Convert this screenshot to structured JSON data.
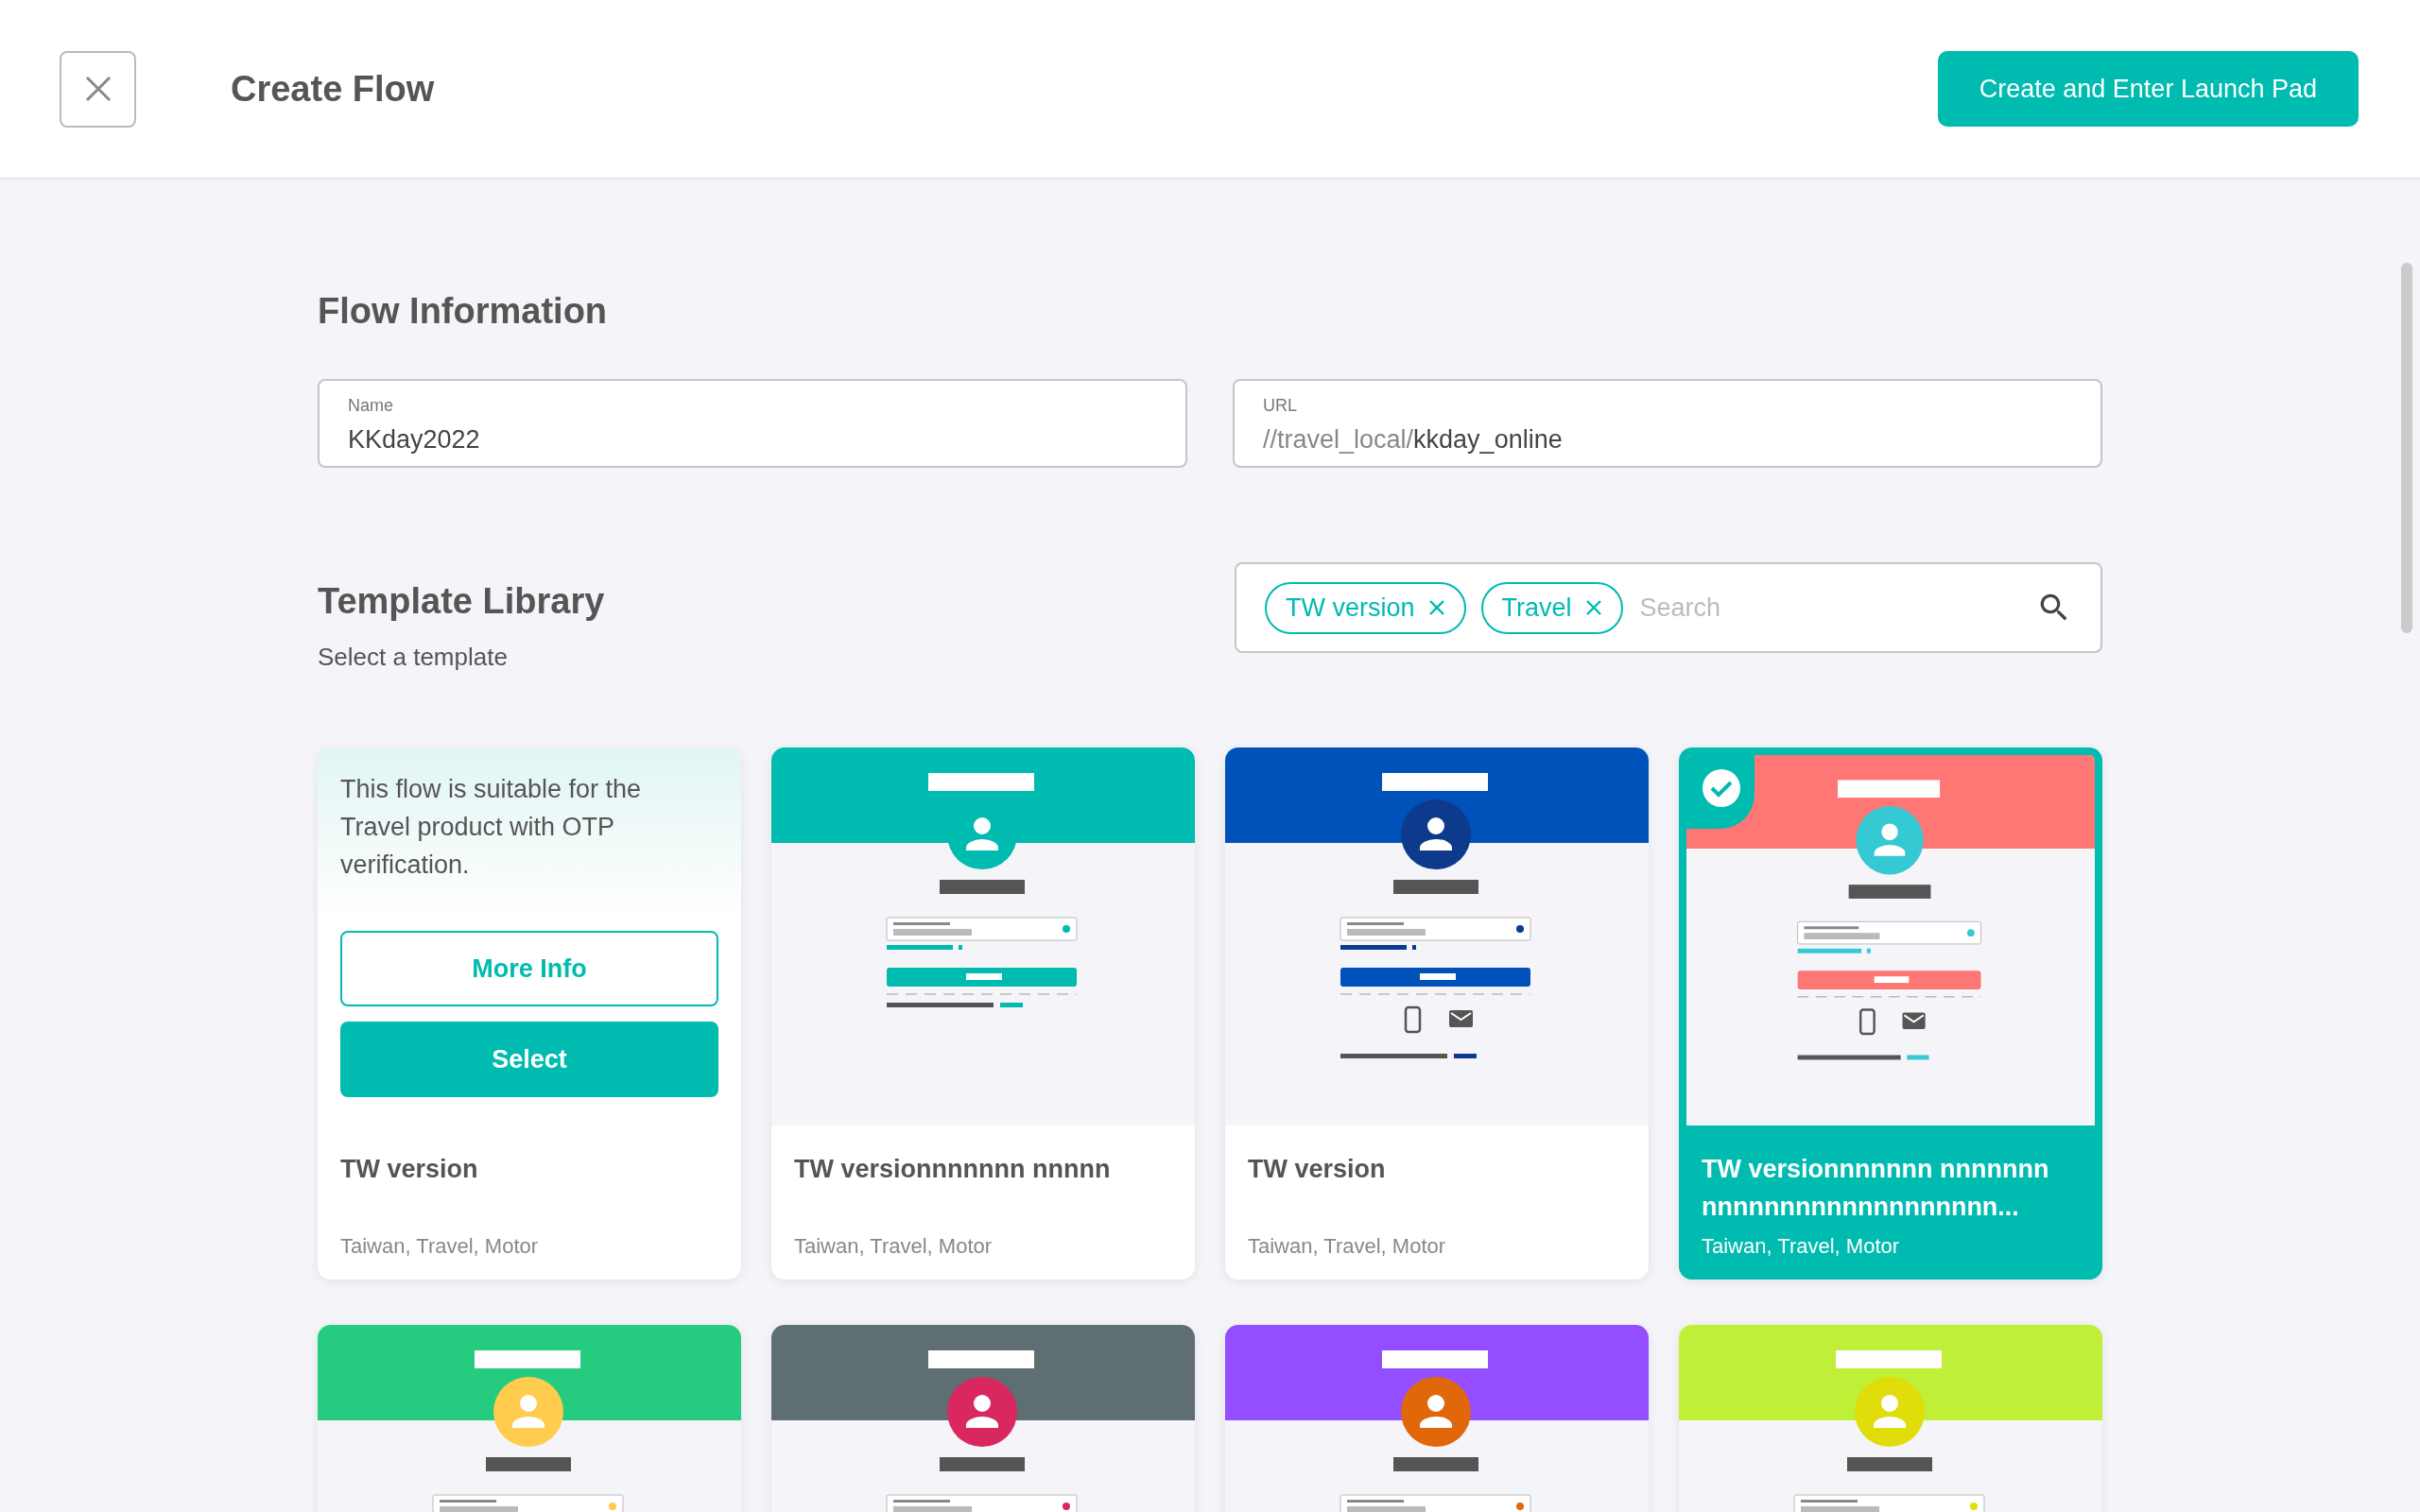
{
  "header": {
    "title": "Create Flow",
    "primary_button": "Create and Enter Launch Pad"
  },
  "flow_information": {
    "heading": "Flow Information",
    "name": {
      "label": "Name",
      "value": "KKday2022"
    },
    "url": {
      "label": "URL",
      "prefix": "//travel_local/",
      "value": "kkday_online"
    }
  },
  "template_library": {
    "heading": "Template Library",
    "subheading": "Select a template",
    "search": {
      "placeholder": "Search",
      "chips": [
        {
          "label": "TW version"
        },
        {
          "label": "Travel"
        }
      ]
    },
    "templates": [
      {
        "title": "TW version",
        "tags": "Taiwan, Travel, Motor",
        "selected": false,
        "hovered": true,
        "description": "This flow is suitable for the Travel product with OTP verification.",
        "more_info": "More Info",
        "select": "Select"
      },
      {
        "title": "TW versionnnnnnn nnnnn",
        "tags": "Taiwan, Travel, Motor",
        "selected": false,
        "hovered": false,
        "color": "#00bbb0",
        "avatar": {
          "color": "#00bbb0"
        },
        "contact_icons": false
      },
      {
        "title": "TW version",
        "tags": "Taiwan, Travel, Motor",
        "selected": false,
        "hovered": false,
        "color": "#0052bb",
        "avatar": {
          "color": "#0d3a8c"
        },
        "contact_icons": true
      },
      {
        "title": "TW versionnnnnnn nnnnnnn nnnnnnnnnnnnnnnnnnn...",
        "tags": "Taiwan, Travel, Motor",
        "selected": true,
        "hovered": false,
        "color": "#ff7775",
        "avatar": {
          "color": "#35c9d3"
        },
        "contact_icons": true
      },
      {
        "selected": false,
        "hovered": false,
        "color": "#25cc80",
        "avatar": {
          "color": "#ffcc4d"
        }
      },
      {
        "selected": false,
        "hovered": false,
        "color": "#5e6e73",
        "avatar": {
          "color": "#d9285f"
        }
      },
      {
        "selected": false,
        "hovered": false,
        "color": "#944dff",
        "avatar": {
          "color": "#e0680b"
        }
      },
      {
        "selected": false,
        "hovered": false,
        "color": "#c0ef37",
        "avatar": {
          "color": "#e0dd0b"
        }
      }
    ]
  }
}
